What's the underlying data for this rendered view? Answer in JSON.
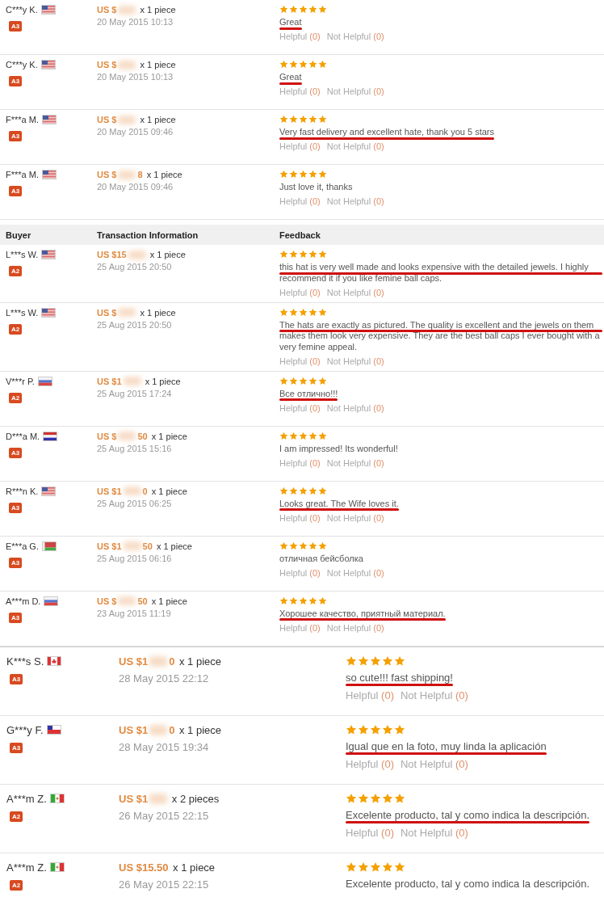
{
  "sections": [
    {
      "kind": "small",
      "rows": [
        {
          "buyer": "C***y K.",
          "kind": "us",
          "badge": "A3",
          "price": "US $",
          "price_end": "",
          "qty": "x 1 piece",
          "date": "20 May 2015 10:13",
          "stars": 5,
          "comment": "Great",
          "marked": true,
          "helpful": {
            "label": "Helpful",
            "count": "(0)",
            "not_label": "Not Helpful",
            "not_count": "(0)"
          }
        },
        {
          "buyer": "C***y K.",
          "kind": "us",
          "badge": "A3",
          "price": "US $",
          "price_end": "",
          "qty": "x 1 piece",
          "date": "20 May 2015 10:13",
          "stars": 5,
          "comment": "Great",
          "marked": true,
          "helpful": {
            "label": "Helpful",
            "count": "(0)",
            "not_label": "Not Helpful",
            "not_count": "(0)"
          }
        },
        {
          "buyer": "F***a M.",
          "kind": "us",
          "badge": "A3",
          "price": "US $",
          "price_end": "",
          "qty": "x 1 piece",
          "date": "20 May 2015 09:46",
          "stars": 5,
          "comment": "Very fast delivery and excellent hate, thank you 5 stars",
          "marked": true,
          "helpful": {
            "label": "Helpful",
            "count": "(0)",
            "not_label": "Not Helpful",
            "not_count": "(0)"
          }
        },
        {
          "buyer": "F***a M.",
          "kind": "us",
          "badge": "A3",
          "price": "US $",
          "price_end": "8",
          "qty": "x 1 piece",
          "date": "20 May 2015 09:46",
          "stars": 5,
          "comment": "Just love it, thanks",
          "marked": false,
          "helpful": {
            "label": "Helpful",
            "count": "(0)",
            "not_label": "Not Helpful",
            "not_count": "(0)"
          }
        }
      ]
    },
    {
      "kind": "small",
      "header": [
        "Buyer",
        "Transaction Information",
        "Feedback"
      ],
      "rows": [
        {
          "buyer": "L***s W.",
          "kind": "us",
          "badge": "A2",
          "price": "US $15",
          "price_end": "",
          "qty": "x 1 piece",
          "date": "25 Aug 2015 20:50",
          "stars": 5,
          "comment": "this hat is very well made and looks expensive with the detailed jewels. I highly recommend it if you like femine ball caps.",
          "marked": true,
          "helpful": {
            "label": "Helpful",
            "count": "(0)",
            "not_label": "Not Helpful",
            "not_count": "(0)"
          }
        },
        {
          "buyer": "L***s W.",
          "kind": "us",
          "badge": "A2",
          "price": "US $",
          "price_end": "",
          "qty": "x 1 piece",
          "date": "25 Aug 2015 20:50",
          "stars": 5,
          "comment": "The hats are exactly as pictured. The quality is excellent and the jewels on them makes them look very expensive. They are the best ball caps I ever bought with a very femine appeal.",
          "marked": true,
          "helpful": {
            "label": "Helpful",
            "count": "(0)",
            "not_label": "Not Helpful",
            "not_count": "(0)"
          }
        },
        {
          "buyer": "V***r P.",
          "kind": "ru",
          "badge": "A2",
          "price": "US $1",
          "price_end": "",
          "qty": "x 1 piece",
          "date": "25 Aug 2015 17:24",
          "stars": 5,
          "comment": "Все отлично!!!",
          "marked": true,
          "helpful": {
            "label": "Helpful",
            "count": "(0)",
            "not_label": "Not Helpful",
            "not_count": "(0)"
          }
        },
        {
          "buyer": "D***a M.",
          "kind": "nl",
          "badge": "A3",
          "price": "US $",
          "price_end": "50",
          "qty": "x 1 piece",
          "date": "25 Aug 2015 15:16",
          "stars": 5,
          "comment": "I am impressed! Its wonderful!",
          "marked": false,
          "helpful": {
            "label": "Helpful",
            "count": "(0)",
            "not_label": "Not Helpful",
            "not_count": "(0)"
          }
        },
        {
          "buyer": "R***n K.",
          "kind": "us",
          "badge": "A3",
          "price": "US $1",
          "price_end": "0",
          "qty": "x 1 piece",
          "date": "25 Aug 2015 06:25",
          "stars": 5,
          "comment": "Looks great. The Wife loves it.",
          "marked": true,
          "helpful": {
            "label": "Helpful",
            "count": "(0)",
            "not_label": "Not Helpful",
            "not_count": "(0)"
          }
        },
        {
          "buyer": "E***a G.",
          "kind": "by",
          "badge": "A3",
          "price": "US $1",
          "price_end": "50",
          "qty": "x 1 piece",
          "date": "25 Aug 2015 06:16",
          "stars": 5,
          "comment": "отличная бейсболка",
          "marked": false,
          "helpful": {
            "label": "Helpful",
            "count": "(0)",
            "not_label": "Not Helpful",
            "not_count": "(0)"
          }
        },
        {
          "buyer": "A***m D.",
          "kind": "ru",
          "badge": "A3",
          "price": "US $",
          "price_end": "50",
          "qty": "x 1 piece",
          "date": "23 Aug 2015 11:19",
          "stars": 5,
          "comment": "Хорошее качество, приятный материал.",
          "marked": true,
          "helpful": {
            "label": "Helpful",
            "count": "(0)",
            "not_label": "Not Helpful",
            "not_count": "(0)"
          }
        }
      ]
    },
    {
      "kind": "large",
      "rows": [
        {
          "buyer": "K***s S.",
          "kind": "ca",
          "badge": "A3",
          "price": "US $1",
          "price_end": "0",
          "qty": "x 1 piece",
          "date": "28 May 2015 22:12",
          "stars": 5,
          "comment": "so cute!!! fast shipping!",
          "marked": true,
          "helpful": {
            "label": "Helpful",
            "count": "(0)",
            "not_label": "Not Helpful",
            "not_count": "(0)"
          }
        },
        {
          "buyer": "G***y F.",
          "kind": "cl",
          "badge": "A3",
          "price": "US $1",
          "price_end": "0",
          "qty": "x 1 piece",
          "date": "28 May 2015 19:34",
          "stars": 5,
          "comment": "Igual que en la foto, muy linda la aplicación",
          "marked": true,
          "helpful": {
            "label": "Helpful",
            "count": "(0)",
            "not_label": "Not Helpful",
            "not_count": "(0)"
          }
        },
        {
          "buyer": "A***m Z.",
          "kind": "mx",
          "badge": "A2",
          "price": "US $1",
          "price_end": "",
          "qty": "x 2 pieces",
          "date": "26 May 2015 22:15",
          "stars": 5,
          "comment": "Excelente producto, tal y como indica la descripción.",
          "marked": true,
          "helpful": {
            "label": "Helpful",
            "count": "(0)",
            "not_label": "Not Helpful",
            "not_count": "(0)"
          }
        },
        {
          "buyer": "A***m Z.",
          "kind": "mx",
          "badge": "A2",
          "price": "US $15.50",
          "price_end": "",
          "qty": "x 1 piece",
          "date": "26 May 2015 22:15",
          "stars": 5,
          "comment": "Excelente producto, tal y como indica la descripción.",
          "marked": false
        }
      ]
    }
  ]
}
